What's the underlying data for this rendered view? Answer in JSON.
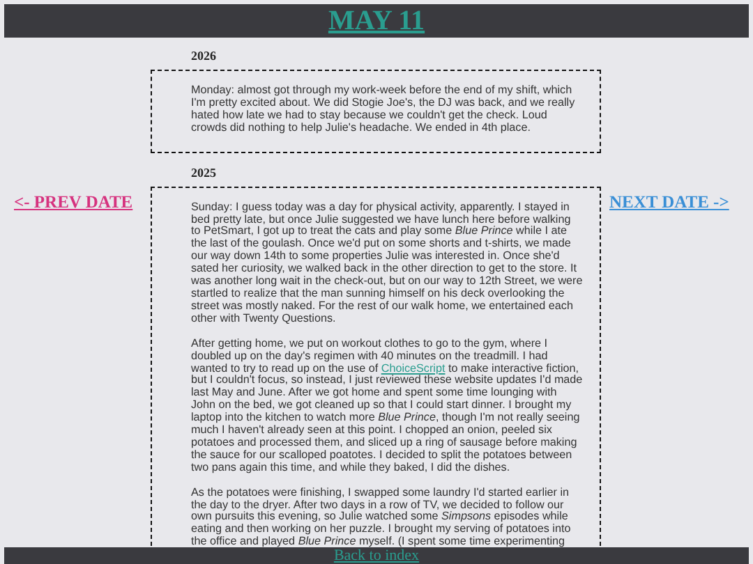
{
  "header": {
    "title": "MAY 11"
  },
  "entries": [
    {
      "year": "2026",
      "paragraphs": [
        {
          "text": "Monday: almost got through my work-week before the end of my shift, which I'm pretty excited about. We did Stogie Joe's, the DJ was back, and we really hated how late we had to stay because we couldn't get the check. Loud crowds did nothing to help Julie's headache. We ended in 4th place."
        }
      ]
    },
    {
      "year": "2025",
      "paragraphs": [
        {
          "text": "Sunday: I guess today was a day for physical activity, apparently. I stayed in bed pretty late, but once Julie suggested we have lunch here before walking to PetSmart, I got up to treat the cats and play some *Blue Prince* while I ate the last of the goulash. Once we'd put on some shorts and t-shirts, we made our way down 14th to some properties Julie was interested in. Once she'd sated her curiosity, we walked back in the other direction to get to the store. It was another long wait in the check-out, but on our way to 12th Street, we were startled to realize that the man sunning himself on his deck overlooking the street was mostly naked. For the rest of our walk home, we entertained each other with Twenty Questions."
        },
        {
          "text": "After getting home, we put on workout clothes to go to the gym, where I doubled up on the day's regimen with 40 minutes on the treadmill. I had wanted to try to read up on the use of",
          "link": "ChoiceScript",
          "after": "to make interactive fiction, but I couldn't focus, so instead, I just reviewed these website updates I'd made last May and June. After we got home and spent some time lounging with John on the bed, we got cleaned up so that I could start dinner. I brought my laptop into the kitchen to watch more *Blue Prince*, though I'm not really seeing much I haven't already seen at this point. I chopped an onion, peeled six potatoes and processed them, and sliced up a ring of sausage before making the sauce for our scalloped poatotes. I decided to split the potatoes between two pans again this time, and while they baked, I did the dishes."
        },
        {
          "text": "As the potatoes were finishing, I swapped some laundry I'd started earlier in the day to the dryer. After two days in a row of TV, we decided to follow our own pursuits this evening, so Julie watched some *Simpsons* episodes while eating and then working on her puzzle. I brought my serving of potatoes into the office and played *Blue Prince* myself. (I spent some time experimenting"
        }
      ]
    }
  ],
  "nav": {
    "prev": "<- PREV DATE",
    "next": "NEXT DATE ->"
  },
  "footer": {
    "link": "Back to index"
  }
}
